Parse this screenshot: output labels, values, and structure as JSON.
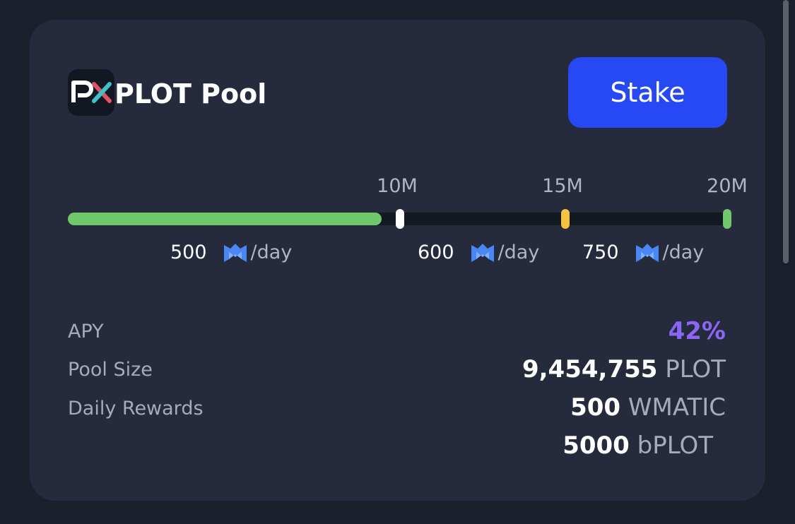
{
  "pool": {
    "title": "PLOT Pool",
    "logo_text": "PX",
    "stake_label": "Stake"
  },
  "progress": {
    "current_value": 9454755,
    "max": 20000000,
    "ticks": [
      {
        "label": "10M",
        "value": 10000000,
        "color": "#ffffff"
      },
      {
        "label": "15M",
        "value": 15000000,
        "color": "#f5c242"
      },
      {
        "label": "20M",
        "value": 20000000,
        "color": "#6fc86a"
      }
    ],
    "fill_color": "#6fc86a",
    "rates": [
      {
        "amount": "500",
        "icon": "polygon-matic-icon",
        "unit": "/day"
      },
      {
        "amount": "600",
        "icon": "polygon-matic-icon",
        "unit": "/day"
      },
      {
        "amount": "750",
        "icon": "polygon-matic-icon",
        "unit": "/day"
      }
    ]
  },
  "stats": {
    "apy": {
      "label": "APY",
      "value": "42%"
    },
    "pool_size": {
      "label": "Pool Size",
      "value": "9,454,755",
      "unit": "PLOT"
    },
    "daily_rewards": {
      "label": "Daily Rewards",
      "items": [
        {
          "value": "500",
          "unit": "WMATIC"
        },
        {
          "value": "5000",
          "unit": "bPLOT"
        }
      ]
    }
  },
  "colors": {
    "accent": "#2648f5",
    "apy": "#8b66f5",
    "card": "#252b3d",
    "background": "#1b202c"
  }
}
